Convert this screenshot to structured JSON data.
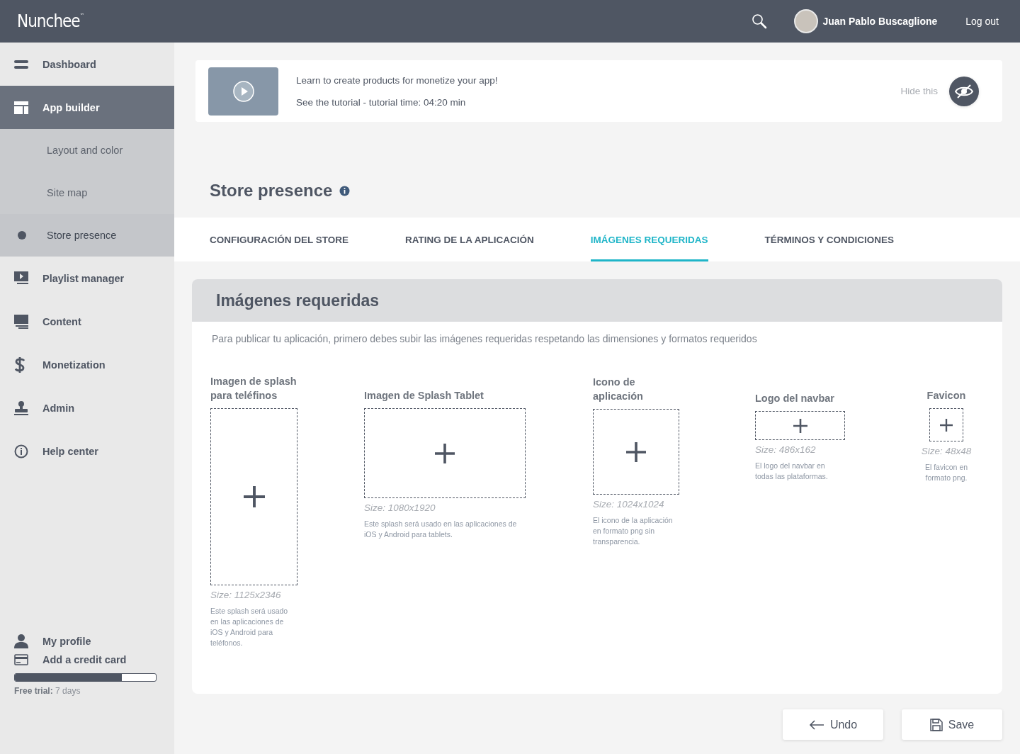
{
  "header": {
    "logo": "Nunchee",
    "logo_mark": "™",
    "user_name": "Juan Pablo Buscaglione",
    "logout": "Log out"
  },
  "sidebar": {
    "items": [
      {
        "label": "Dashboard",
        "selected": false
      },
      {
        "label": "App builder",
        "selected": true,
        "expanded": true,
        "children": [
          {
            "label": "Layout and color",
            "selected": false
          },
          {
            "label": "Site map",
            "selected": false
          },
          {
            "label": "Store presence",
            "selected": true
          }
        ]
      },
      {
        "label": "Playlist manager",
        "selected": false
      },
      {
        "label": "Content",
        "selected": false
      },
      {
        "label": "Monetization",
        "selected": false
      },
      {
        "label": "Admin",
        "selected": false
      },
      {
        "label": "Help center",
        "selected": false
      }
    ],
    "footer_links": [
      {
        "label": "My profile"
      },
      {
        "label": "Add a credit card"
      }
    ],
    "trial": {
      "level": 0.76,
      "text": "**Free trial:** 7 days"
    }
  },
  "tutorial": {
    "line_1": "Learn to create products for monetize your app!",
    "line_2": "See the tutorial - tutorial time: 04:20 min",
    "hide_label": "Hide this"
  },
  "page_title": "Store presence",
  "tabs": [
    {
      "label": "CONFIGURACIÓN DEL STORE",
      "selected": false
    },
    {
      "label": "RATING DE LA APLICACIÓN",
      "selected": false
    },
    {
      "label": "IMÁGENES REQUERIDAS",
      "selected": true
    },
    {
      "label": "TÉRMINOS Y CONDICIONES",
      "selected": false
    }
  ],
  "section": {
    "title": "Imágenes requeridas",
    "intro": "Para publicar tu aplicación, primero debes subir las imágenes requeridas respetando las dimensiones y formatos requeridos",
    "slots": [
      {
        "label": "Imagen de splash para teléfinos",
        "size": "Size: 1125x2346",
        "description": "Este splash será usado en las aplicaciones de iOS y Android para teléfonos."
      },
      {
        "label": "Imagen de Splash Tablet",
        "size": "Size: 1080x1920",
        "description": "Este splash será usado en las aplicaciones de iOS y Android para tablets."
      },
      {
        "label": "Icono de aplicación",
        "size": "Size: 1024x1024",
        "description": "El icono de la aplicación en formato png sin transparencia."
      },
      {
        "label": "Logo del navbar",
        "size": "Size: 486x162",
        "description": "El logo del navbar en todas las plataformas."
      },
      {
        "label": "Favicon",
        "size": "Size: 48x48",
        "description": "El favicon en formato png."
      }
    ]
  },
  "buttons": [
    {
      "label": "Undo",
      "kind": "undo"
    },
    {
      "label": "Save",
      "kind": "save"
    }
  ]
}
